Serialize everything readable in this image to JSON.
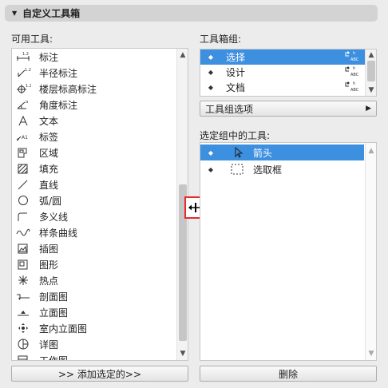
{
  "header": {
    "title": "自定义工具箱"
  },
  "available": {
    "label": "可用工具:",
    "items": [
      {
        "label": "标注",
        "icon": "linear-dimension-icon"
      },
      {
        "label": "半径标注",
        "icon": "radial-dimension-icon"
      },
      {
        "label": "楼层标高标注",
        "icon": "level-dimension-icon"
      },
      {
        "label": "角度标注",
        "icon": "angle-dimension-icon"
      },
      {
        "label": "文本",
        "icon": "text-icon"
      },
      {
        "label": "标签",
        "icon": "label-icon"
      },
      {
        "label": "区域",
        "icon": "zone-icon"
      },
      {
        "label": "填充",
        "icon": "fill-icon"
      },
      {
        "label": "直线",
        "icon": "line-icon"
      },
      {
        "label": "弧/圆",
        "icon": "arc-circle-icon"
      },
      {
        "label": "多义线",
        "icon": "polyline-icon"
      },
      {
        "label": "样条曲线",
        "icon": "spline-icon"
      },
      {
        "label": "插图",
        "icon": "figure-icon"
      },
      {
        "label": "图形",
        "icon": "drawing-icon"
      },
      {
        "label": "热点",
        "icon": "hotspot-icon"
      },
      {
        "label": "剖面图",
        "icon": "section-icon"
      },
      {
        "label": "立面图",
        "icon": "elevation-icon"
      },
      {
        "label": "室内立面图",
        "icon": "interior-elevation-icon"
      },
      {
        "label": "详图",
        "icon": "detail-icon"
      },
      {
        "label": "工作图",
        "icon": "worksheet-icon"
      }
    ],
    "add_button": ">> 添加选定的>>"
  },
  "groups": {
    "label": "工具箱组:",
    "items": [
      {
        "label": "选择",
        "selected": true
      },
      {
        "label": "设计",
        "selected": false
      },
      {
        "label": "文档",
        "selected": false
      }
    ],
    "options_button": "工具组选项"
  },
  "group_tools": {
    "label": "选定组中的工具:",
    "items": [
      {
        "label": "箭头",
        "icon": "arrow-pointer-icon",
        "selected": true
      },
      {
        "label": "选取框",
        "icon": "marquee-icon",
        "selected": false
      }
    ],
    "delete_button": "删除"
  },
  "colors": {
    "selection": "#3d8fe0",
    "highlight_box": "#e8292c"
  }
}
